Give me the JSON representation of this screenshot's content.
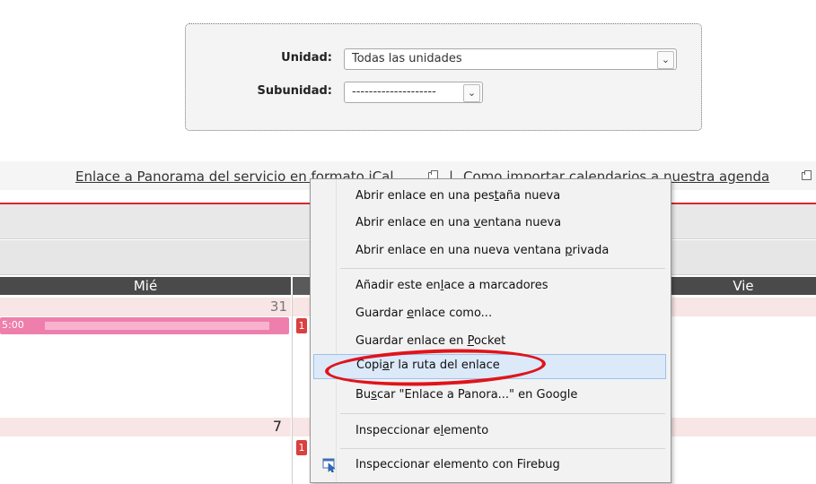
{
  "filters": {
    "unidad_label": "Unidad:",
    "unidad_value": "Todas las unidades",
    "subunidad_label": "Subunidad:",
    "subunidad_value": "--------------------"
  },
  "links": {
    "ical": "Enlace a Panorama del servicio en formato iCal",
    "separator": "|",
    "import": "Como importar calendarios a nuestra agenda"
  },
  "calendar": {
    "day_headers": [
      "Mié",
      "Vie"
    ],
    "week1_day": "31",
    "week2_day": "7",
    "event_time": "5:00",
    "badge": "1"
  },
  "context_menu": {
    "items": [
      {
        "pre": "Abrir enlace en una pes",
        "u": "t",
        "post": "aña nueva"
      },
      {
        "pre": "Abrir enlace en una ",
        "u": "v",
        "post": "entana nueva"
      },
      {
        "pre": "Abrir enlace en una nueva ventana ",
        "u": "p",
        "post": "rivada"
      },
      {
        "pre": "Añadir este en",
        "u": "l",
        "post": "ace a marcadores"
      },
      {
        "pre": "Guardar ",
        "u": "e",
        "post": "nlace como..."
      },
      {
        "pre": "Guardar enlace en ",
        "u": "P",
        "post": "ocket"
      },
      {
        "pre": "Copi",
        "u": "a",
        "post": "r la ruta del enlace"
      },
      {
        "pre": "Bu",
        "u": "s",
        "post": "car \"Enlace a Panora...\" en Google"
      },
      {
        "pre": "Inspeccionar e",
        "u": "l",
        "post": "emento"
      },
      {
        "pre": "Inspeccionar elemento con Firebug",
        "u": "",
        "post": ""
      }
    ],
    "highlighted_index": 6
  },
  "colors": {
    "accent_red": "#d9262c",
    "event_pink": "#ee7fad",
    "highlight": "#dbe9f9",
    "annotation_oval": "#e0141b"
  },
  "icons": [
    "chevron-down-icon",
    "external-link-icon",
    "firebug-inspect-icon"
  ]
}
